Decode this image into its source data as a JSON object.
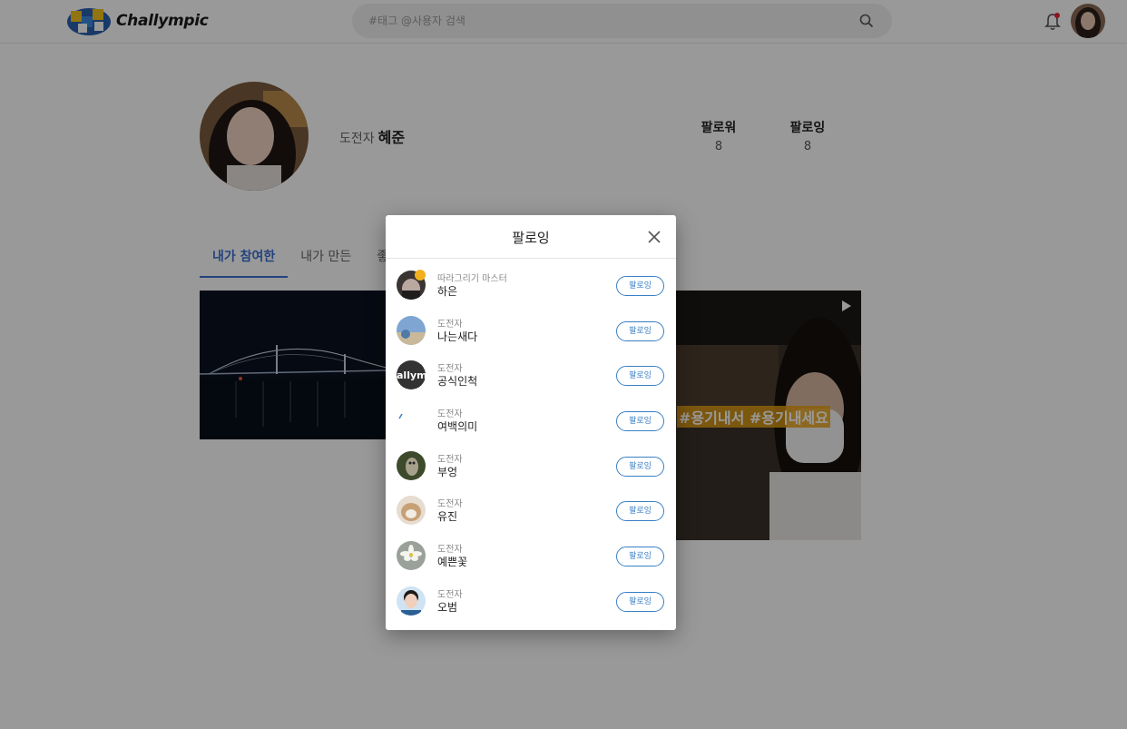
{
  "app": {
    "title": "Challympic"
  },
  "header": {
    "logo_text": "Challympic",
    "search_placeholder": "#태그 @사용자 검색",
    "icons": [
      "search-icon",
      "bell-icon"
    ]
  },
  "profile": {
    "role": "도전자",
    "name": "혜준",
    "followers_label": "팔로워",
    "followers_count": "8",
    "following_label": "팔로잉",
    "following_count": "8"
  },
  "tabs": [
    {
      "label": "내가 참여한",
      "active": true
    },
    {
      "label": "내가 만든",
      "active": false
    },
    {
      "label": "좋",
      "active": false
    }
  ],
  "thumbnails": {
    "second_tag_text": "#용기내서 #용기내세요"
  },
  "modal": {
    "title": "팔로잉",
    "button_label": "팔로잉",
    "users": [
      {
        "title": "따라그리기 마스터",
        "name": "하은"
      },
      {
        "title": "도전자",
        "name": "나는새다"
      },
      {
        "title": "도전자",
        "name": "공식인척"
      },
      {
        "title": "도전자",
        "name": "여백의미"
      },
      {
        "title": "도전자",
        "name": "부엉"
      },
      {
        "title": "도전자",
        "name": "유진"
      },
      {
        "title": "도전자",
        "name": "예쁜꽃"
      },
      {
        "title": "도전자",
        "name": "오범"
      }
    ]
  },
  "colors": {
    "accent": "#3b6fd4",
    "follow_button": "#3b7fc4",
    "notification_dot": "#ee2233"
  }
}
